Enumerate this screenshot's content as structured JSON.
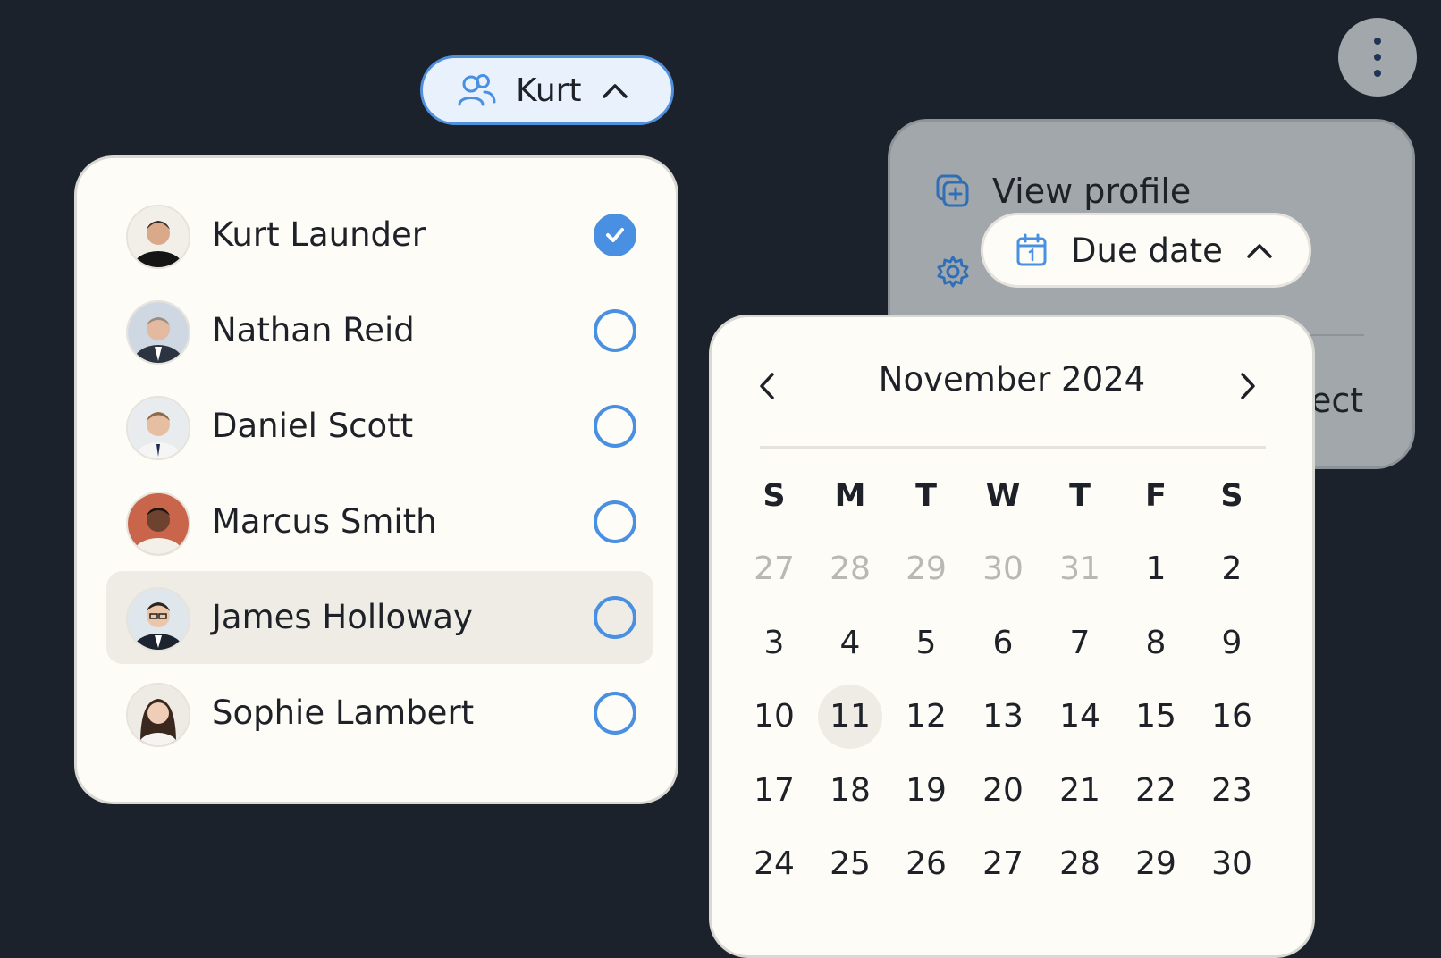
{
  "assignee_button": {
    "label": "Kurt",
    "icon": "users-icon",
    "chevron": "chevron-up-icon"
  },
  "assignees": [
    {
      "name": "Kurt Launder",
      "selected": true,
      "highlighted": false
    },
    {
      "name": "Nathan Reid",
      "selected": false,
      "highlighted": false
    },
    {
      "name": "Daniel Scott",
      "selected": false,
      "highlighted": false
    },
    {
      "name": "Marcus Smith",
      "selected": false,
      "highlighted": false
    },
    {
      "name": "James Holloway",
      "selected": false,
      "highlighted": true
    },
    {
      "name": "Sophie Lambert",
      "selected": false,
      "highlighted": false
    }
  ],
  "profile_menu": {
    "items": [
      {
        "label": "View profile",
        "icon": "add-square-icon"
      },
      {
        "label": "",
        "icon": "gear-icon"
      }
    ],
    "tail_text": "ect"
  },
  "due_date_button": {
    "label": "Due date",
    "icon": "calendar-icon",
    "chevron": "chevron-up-icon"
  },
  "calendar": {
    "month_label": "November 2024",
    "weekdays": [
      "S",
      "M",
      "T",
      "W",
      "T",
      "F",
      "S"
    ],
    "weeks": [
      [
        "27",
        "28",
        "29",
        "30",
        "31",
        "1",
        "2"
      ],
      [
        "3",
        "4",
        "5",
        "6",
        "7",
        "8",
        "9"
      ],
      [
        "10",
        "11",
        "12",
        "13",
        "14",
        "15",
        "16"
      ],
      [
        "17",
        "18",
        "19",
        "20",
        "21",
        "22",
        "23"
      ],
      [
        "24",
        "25",
        "26",
        "27",
        "28",
        "29",
        "30"
      ]
    ],
    "muted_prev_month_days": 5,
    "today": "11"
  },
  "colors": {
    "background": "#1b222c",
    "accent": "#4a90e2",
    "panel": "#fdfcf6",
    "highlight": "#efece6",
    "dimmed": "#a2a7ab"
  }
}
